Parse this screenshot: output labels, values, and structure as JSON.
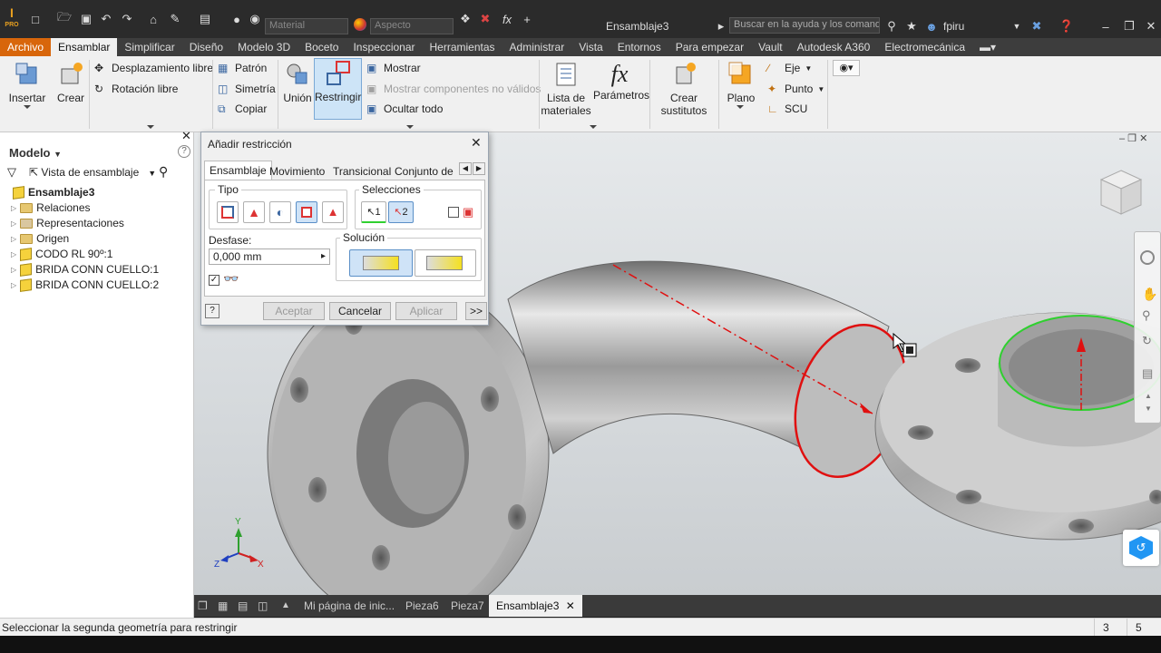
{
  "window": {
    "title": "Ensamblaje3",
    "material_placeholder": "Material",
    "appearance_placeholder": "Aspecto",
    "search_placeholder": "Buscar en la ayuda y los comandos",
    "user": "fpiru"
  },
  "menu": [
    "Archivo",
    "Ensamblar",
    "Simplificar",
    "Diseño",
    "Modelo 3D",
    "Boceto",
    "Inspeccionar",
    "Herramientas",
    "Administrar",
    "Vista",
    "Entornos",
    "Para empezar",
    "Vault",
    "Autodesk A360",
    "Electromecánica"
  ],
  "ribbon": {
    "insertar": "Insertar",
    "crear": "Crear",
    "desplazamiento": "Desplazamiento libre",
    "rotacion": "Rotación libre",
    "patron": "Patrón",
    "simetria": "Simetría",
    "copiar": "Copiar",
    "union": "Unión",
    "restringir": "Restringir",
    "mostrar": "Mostrar",
    "mostrar_comp": "Mostrar componentes no válidos",
    "ocultar": "Ocultar todo",
    "lista": "Lista de",
    "materiales": "materiales",
    "parametros": "Parámetros",
    "crear_sust": "Crear",
    "sustitutos": "sustitutos",
    "plano": "Plano",
    "eje": "Eje",
    "punto": "Punto",
    "scu": "SCU"
  },
  "browser": {
    "title": "Modelo",
    "view": "Vista de ensamblaje",
    "root": "Ensamblaje3",
    "items": [
      "Relaciones",
      "Representaciones",
      "Origen",
      "CODO RL 90º:1",
      "BRIDA CONN CUELLO:1",
      "BRIDA CONN CUELLO:2"
    ]
  },
  "dialog": {
    "title": "Añadir restricción",
    "tabs": [
      "Ensamblaje",
      "Movimiento",
      "Transicional",
      "Conjunto de"
    ],
    "tipo": "Tipo",
    "selecciones": "Selecciones",
    "sel1": "1",
    "sel2": "2",
    "desfase_label": "Desfase:",
    "desfase_value": "0,000 mm",
    "solucion": "Solución",
    "aceptar": "Aceptar",
    "cancelar": "Cancelar",
    "aplicar": "Aplicar",
    "more": ">>"
  },
  "doc_tabs": [
    "Mi página de inic...",
    "Pieza6",
    "Pieza7",
    "Ensamblaje3"
  ],
  "status": {
    "message": "Seleccionar la segunda geometría para restringir",
    "n1": "3",
    "n2": "5"
  },
  "colors": {
    "accent": "#d8660b",
    "selection_red": "#e01010",
    "selection_green": "#2fd02f",
    "steel": "#a8a8a8"
  }
}
